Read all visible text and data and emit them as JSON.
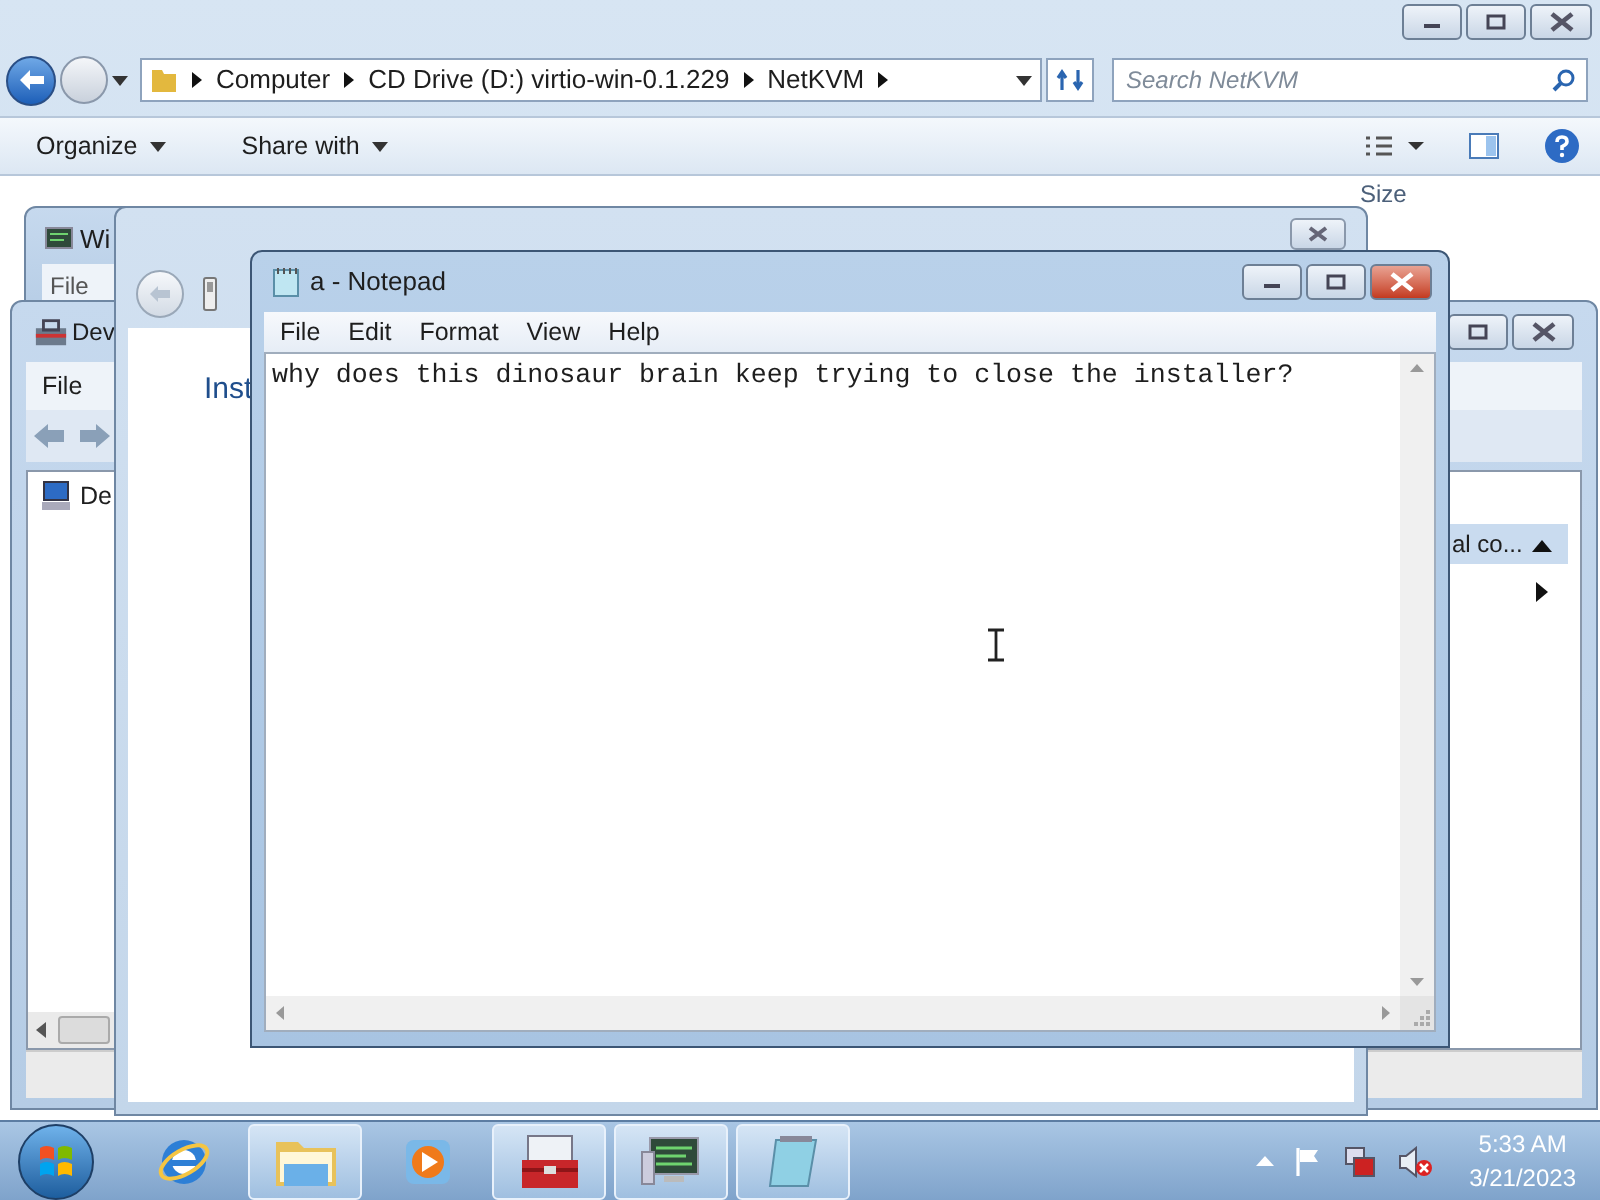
{
  "explorer": {
    "path": [
      "Computer",
      "CD Drive (D:) virtio-win-0.1.229",
      "NetKVM"
    ],
    "search": {
      "placeholder": "Search NetKVM"
    },
    "commands": [
      "Organize",
      "Share with"
    ],
    "columns": [
      "Size"
    ]
  },
  "back_window": {
    "title": "Wi",
    "menu": [
      "File"
    ]
  },
  "device_manager": {
    "title": "Dev",
    "menu": [
      "File"
    ],
    "tree": [
      "De"
    ],
    "group_header": "al co..."
  },
  "installer": {
    "heading": "Inst"
  },
  "notepad": {
    "title": "a - Notepad",
    "menu": [
      "File",
      "Edit",
      "Format",
      "View",
      "Help"
    ],
    "text": "why does this dinosaur brain keep trying to close the installer?"
  },
  "taskbar": {
    "apps": [
      {
        "kind": "browser",
        "running": false
      },
      {
        "kind": "folders",
        "running": true
      },
      {
        "kind": "media",
        "running": false
      },
      {
        "kind": "toolbox",
        "running": true
      },
      {
        "kind": "monitor",
        "running": true
      },
      {
        "kind": "notepad",
        "running": true
      }
    ],
    "clock": {
      "time": "5:33 AM",
      "date": "3/21/2023"
    }
  }
}
